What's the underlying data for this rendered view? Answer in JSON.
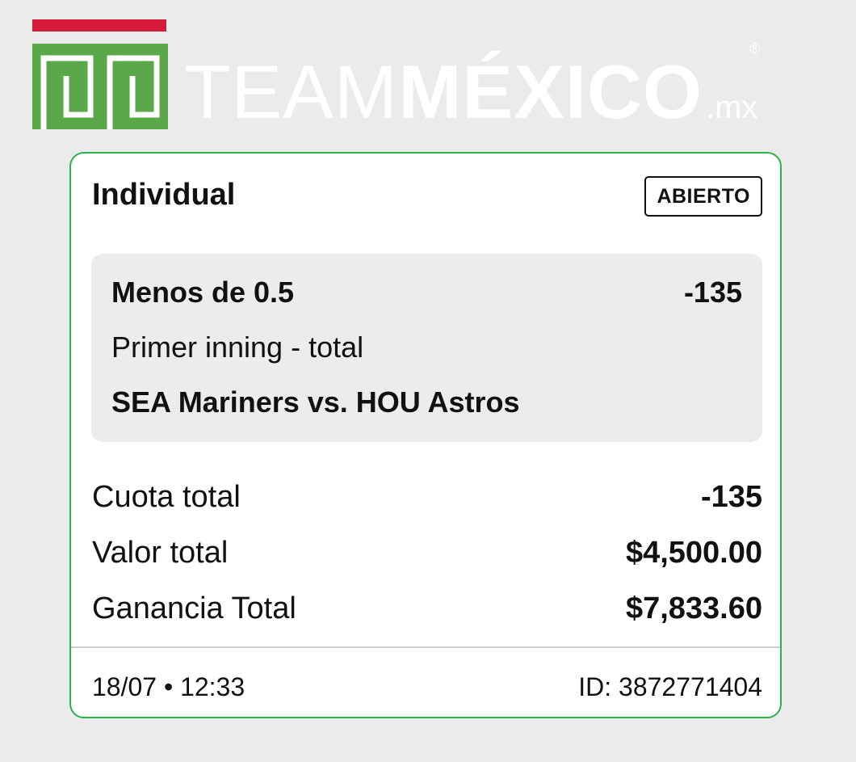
{
  "logo": {
    "word_light": "TEAM",
    "word_bold": "MÉXICO",
    "domain": ".mx",
    "registered": "®",
    "colors": {
      "green": "#5ba84a",
      "red": "#d61a3c",
      "text": "#ffffff"
    }
  },
  "ticket": {
    "bet_type": "Individual",
    "status": "ABIERTO",
    "accent_color": "#2bb24c",
    "selection": {
      "pick": "Menos de 0.5",
      "odds": "-135",
      "market": "Primer inning - total",
      "event": "SEA Mariners vs. HOU Astros"
    },
    "summary": [
      {
        "label": "Cuota total",
        "value": "-135"
      },
      {
        "label": "Valor total",
        "value": "$4,500.00"
      },
      {
        "label": "Ganancia Total",
        "value": "$7,833.60"
      }
    ],
    "footer": {
      "datetime": "18/07 • 12:33",
      "id": "ID: 3872771404"
    }
  }
}
